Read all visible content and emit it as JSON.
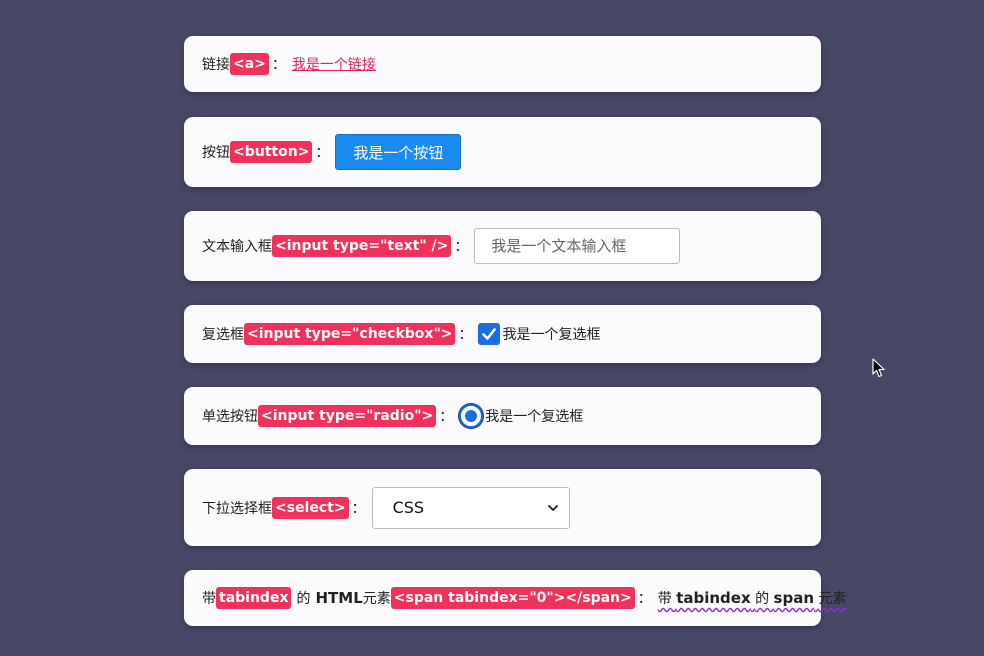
{
  "rows": {
    "link": {
      "label": "链接",
      "tag": "<a>",
      "colon": "：",
      "link_text": "我是一个链接"
    },
    "button": {
      "label": "按钮",
      "tag": "<button>",
      "colon": "：",
      "button_text": "我是一个按钮"
    },
    "text_input": {
      "label": "文本输入框",
      "tag": "<input type=\"text\" />",
      "colon": "：",
      "placeholder": "我是一个文本输入框"
    },
    "checkbox": {
      "label": "复选框",
      "tag": "<input type=\"checkbox\">",
      "colon": "：",
      "checked": true,
      "option_text": "我是一个复选框"
    },
    "radio": {
      "label": "单选按钮",
      "tag": "<input type=\"radio\">",
      "colon": "：",
      "checked": true,
      "option_text": "我是一个复选框"
    },
    "select": {
      "label": "下拉选择框",
      "tag": "<select>",
      "colon": "：",
      "selected": "CSS"
    },
    "tabindex": {
      "prefix": "带",
      "tag1": "tabindex",
      "middle_de": "的",
      "middle_html": "HTML",
      "middle_elem": "元素",
      "tag2": "<span tabindex=\"0\"></span>",
      "colon": "：",
      "span_pre": "带",
      "span_tabindex": "tabindex",
      "span_de": "的",
      "span_span": "span",
      "span_elem": "元素"
    }
  },
  "colors": {
    "background": "#474766",
    "card": "#fbfbfd",
    "tag": "#f0325a",
    "link": "#e0245e",
    "accent": "#1a6fe0",
    "button": "#1a8cf0",
    "wavy_underline": "#8a2be2"
  },
  "icons": {
    "checkbox_mark": "check-icon",
    "select_arrow": "chevron-down-icon",
    "cursor": "mouse-pointer-icon"
  }
}
